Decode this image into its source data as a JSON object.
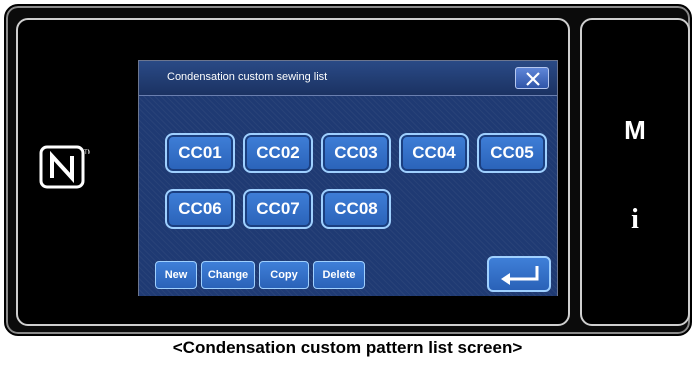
{
  "screen": {
    "title": "Condensation custom sewing list",
    "close_icon": "close-icon",
    "pattern_buttons": [
      "CC01",
      "CC02",
      "CC03",
      "CC04",
      "CC05",
      "CC06",
      "CC07",
      "CC08"
    ],
    "bottom_buttons": {
      "new": "New",
      "change": "Change",
      "copy": "Copy",
      "delete": "Delete"
    },
    "enter_icon": "enter-icon"
  },
  "side_panel": {
    "mode_key": "M",
    "info_key": "i"
  },
  "nfc_icon": "nfc-icon",
  "caption": "<Condensation custom pattern list screen>"
}
